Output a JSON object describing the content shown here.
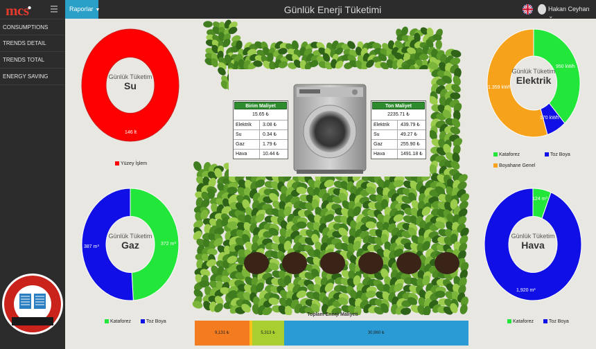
{
  "app": {
    "logo": "mcs",
    "title": "Günlük Enerji Tüketimi",
    "menu_label": "Raporlar",
    "user_name": "Hakan Ceyhan"
  },
  "sidebar": {
    "items": [
      {
        "label": "CONSUMPTIONS"
      },
      {
        "label": "TRENDS DETAIL"
      },
      {
        "label": "TRENDS TOTAL"
      },
      {
        "label": "ENERGY SAVING"
      }
    ]
  },
  "badge": {
    "text": "ST ENDÜSTRİ DERGİLERİ",
    "sub": "HABER"
  },
  "donuts": {
    "center_caption": "Günlük Tüketim",
    "su": {
      "title": "Su",
      "values": [
        "146 lt"
      ],
      "legend": [
        "Yüzey İşlem"
      ]
    },
    "elektrik": {
      "title": "Elektrik",
      "values": [
        "950 kWh",
        "170 kWh",
        "1.359 kWh"
      ],
      "legend": [
        "Kataforez",
        "Toz Boya",
        "Boyahane Genel"
      ]
    },
    "gaz": {
      "title": "Gaz",
      "values": [
        "372 m³",
        "387 m³"
      ],
      "legend": [
        "Kataforez",
        "Toz Boya"
      ]
    },
    "hava": {
      "title": "Hava",
      "values": [
        "124 m³",
        "1,920 m³"
      ],
      "legend": [
        "Kataforez",
        "Toz Boya"
      ]
    }
  },
  "chart_data": [
    {
      "type": "pie",
      "title": "Su",
      "categories": [
        "Yüzey İşlem"
      ],
      "values": [
        146
      ],
      "unit": "lt"
    },
    {
      "type": "pie",
      "title": "Elektrik",
      "categories": [
        "Kataforez",
        "Toz Boya",
        "Boyahane Genel"
      ],
      "values": [
        950,
        170,
        1359
      ],
      "unit": "kWh"
    },
    {
      "type": "pie",
      "title": "Gaz",
      "categories": [
        "Kataforez",
        "Toz Boya"
      ],
      "values": [
        372,
        387
      ],
      "unit": "m³"
    },
    {
      "type": "pie",
      "title": "Hava",
      "categories": [
        "Kataforez",
        "Toz Boya"
      ],
      "values": [
        124,
        1920
      ],
      "unit": "m³"
    },
    {
      "type": "bar",
      "title": "Toplam Enerji Maliyeti",
      "categories": [
        "",
        "",
        "",
        ""
      ],
      "values": [
        9131,
        491,
        5313,
        30960
      ],
      "labels": [
        "9,131 ₺",
        "",
        "5,313 ₺",
        "30,960 ₺"
      ]
    }
  ],
  "unit_cost": {
    "title": "Birim Maliyet",
    "total": "15.65 ₺",
    "rows": [
      {
        "k": "Elektrik",
        "v": "3.08 ₺"
      },
      {
        "k": "Su",
        "v": "0.34 ₺"
      },
      {
        "k": "Gaz",
        "v": "1.79 ₺"
      },
      {
        "k": "Hava",
        "v": "10.44 ₺"
      }
    ]
  },
  "ton_cost": {
    "title": "Ton Maliyet",
    "total": "2235.71 ₺",
    "rows": [
      {
        "k": "Elektrik",
        "v": "439.79 ₺"
      },
      {
        "k": "Su",
        "v": "49.27 ₺"
      },
      {
        "k": "Gaz",
        "v": "255.90 ₺"
      },
      {
        "k": "Hava",
        "v": "1491.18 ₺"
      }
    ]
  },
  "colors": {
    "kataforez": "#22e639",
    "toz_boya": "#1010e6",
    "genel": "#f7a21b",
    "su": "#ff0000",
    "bar": [
      "#f47c20",
      "#f7c21b",
      "#a8cf2f",
      "#2b9bd6"
    ]
  }
}
